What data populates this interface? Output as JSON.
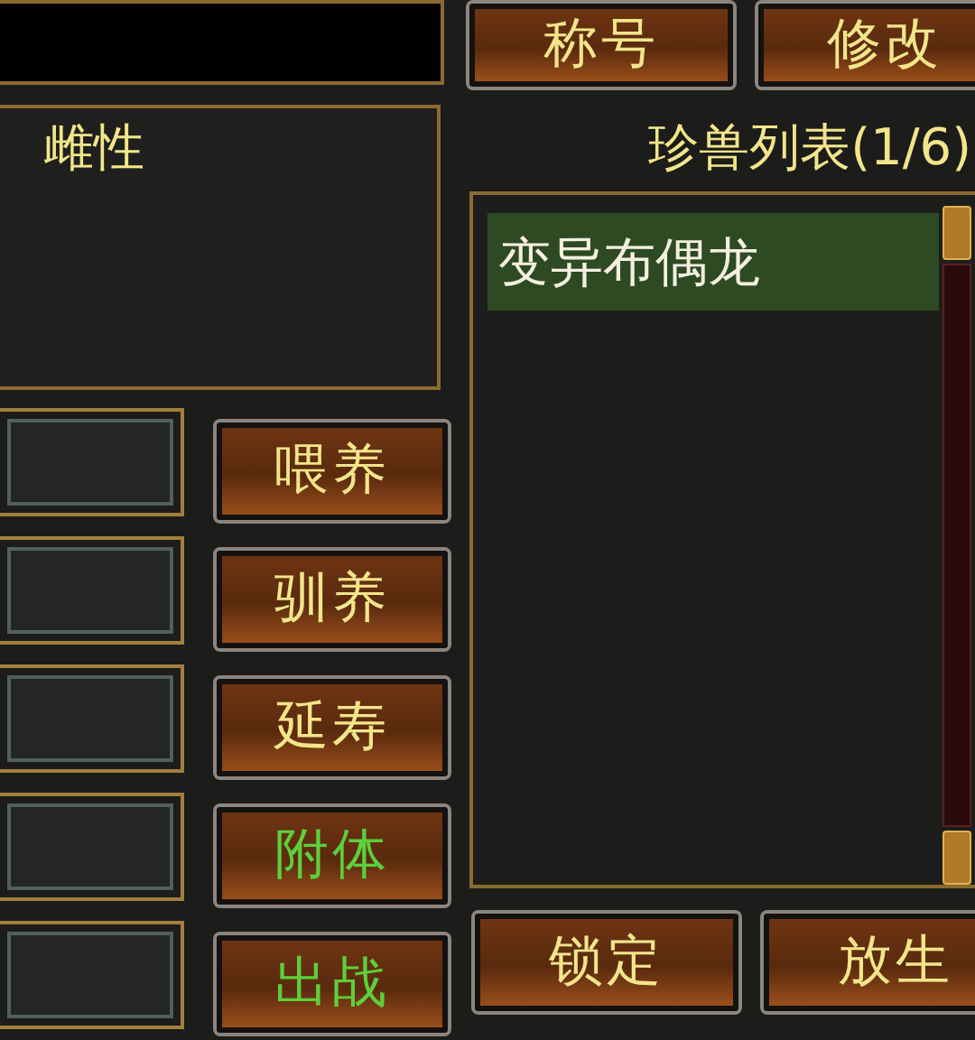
{
  "top_buttons": [
    {
      "label": "称号"
    },
    {
      "label": "修改"
    }
  ],
  "gender": "雌性",
  "action_buttons": [
    {
      "label": "喂养",
      "highlighted": false
    },
    {
      "label": "驯养",
      "highlighted": false
    },
    {
      "label": "延寿",
      "highlighted": false
    },
    {
      "label": "附体",
      "highlighted": true
    },
    {
      "label": "出战",
      "highlighted": true
    }
  ],
  "pet_list": {
    "title": "珍兽列表(1/6)",
    "items": [
      {
        "name": "变异布偶龙",
        "selected": true
      }
    ]
  },
  "bottom_buttons": [
    {
      "label": "锁定"
    },
    {
      "label": "放生"
    }
  ]
}
